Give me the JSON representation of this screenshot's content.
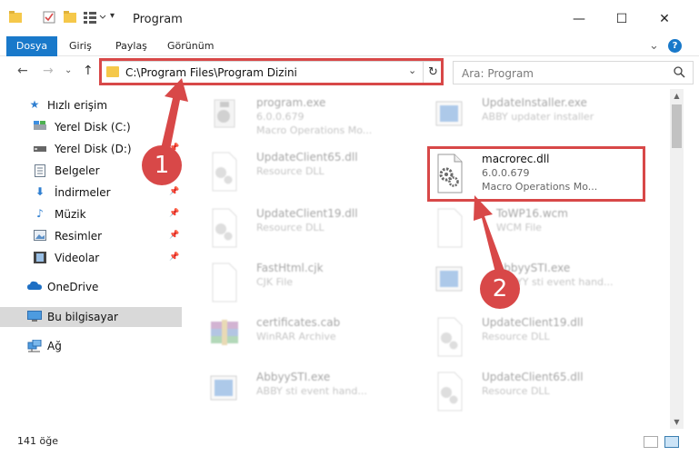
{
  "window": {
    "title": "Program",
    "minimize": "—",
    "maximize": "☐",
    "close": "✕"
  },
  "ribbon": {
    "tabs": [
      "Dosya",
      "Giriş",
      "Paylaş",
      "Görünüm"
    ],
    "expand": "⌄",
    "help": "?"
  },
  "address": {
    "path": "C:\\Program Files\\Program Dizini",
    "dropdown": "⌄",
    "refresh": "↻"
  },
  "search": {
    "placeholder": "Ara: Program",
    "icon": "search-icon"
  },
  "nav": {
    "back": "←",
    "forward": "→",
    "recent": "⌄",
    "up": "↑",
    "items": [
      {
        "label": "Hızlı erişim",
        "icon": "star-icon",
        "pinned": false
      },
      {
        "label": "Yerel Disk (C:)",
        "icon": "drive-icon",
        "pinned": true
      },
      {
        "label": "Yerel Disk (D:)",
        "icon": "drive-icon",
        "pinned": true
      },
      {
        "label": "Belgeler",
        "icon": "document-icon",
        "pinned": true
      },
      {
        "label": "İndirmeler",
        "icon": "download-icon",
        "pinned": true
      },
      {
        "label": "Müzik",
        "icon": "music-icon",
        "pinned": true
      },
      {
        "label": "Resimler",
        "icon": "pictures-icon",
        "pinned": true
      },
      {
        "label": "Videolar",
        "icon": "video-icon",
        "pinned": true
      },
      {
        "label": "OneDrive",
        "icon": "cloud-icon",
        "pinned": false
      },
      {
        "label": "Bu bilgisayar",
        "icon": "computer-icon",
        "pinned": false
      },
      {
        "label": "Ağ",
        "icon": "network-icon",
        "pinned": false
      }
    ]
  },
  "files": [
    {
      "name": "program.exe",
      "line1": "6.0.0.679",
      "line2": "Macro Operations Mo...",
      "icon": "exe-icon",
      "faded": true
    },
    {
      "name": "UpdateInstaller.exe",
      "line1": "ABBY updater installer",
      "line2": "",
      "icon": "installer-icon",
      "faded": true
    },
    {
      "name": "UpdateClient65.dll",
      "line1": "Resource DLL",
      "line2": "",
      "icon": "dll-icon",
      "faded": true
    },
    {
      "name": "macrorec.dll",
      "line1": "6.0.0.679",
      "line2": "Macro Operations Mo...",
      "icon": "dll-icon",
      "faded": false
    },
    {
      "name": "UpdateClient19.dll",
      "line1": "Resource DLL",
      "line2": "",
      "icon": "dll-icon",
      "faded": true
    },
    {
      "name": "ToWP16.wcm",
      "line1": "WCM File",
      "line2": "",
      "icon": "file-icon",
      "faded": true
    },
    {
      "name": "FastHtml.cjk",
      "line1": "CJK File",
      "line2": "",
      "icon": "file-icon",
      "faded": true
    },
    {
      "name": "AbbyySTI.exe",
      "line1": "ABBYY sti event hand...",
      "line2": "",
      "icon": "exe-icon",
      "faded": true
    },
    {
      "name": "certificates.cab",
      "line1": "WinRAR Archive",
      "line2": "",
      "icon": "archive-icon",
      "faded": true
    },
    {
      "name": "UpdateClient19.dll",
      "line1": "Resource DLL",
      "line2": "",
      "icon": "dll-icon",
      "faded": true
    },
    {
      "name": "AbbyySTI.exe",
      "line1": "ABBY sti event hand...",
      "line2": "",
      "icon": "exe-icon",
      "faded": true
    },
    {
      "name": "UpdateClient65.dll",
      "line1": "Resource DLL",
      "line2": "",
      "icon": "dll-icon",
      "faded": true
    }
  ],
  "status": {
    "count": "141 öğe"
  },
  "annotations": {
    "step1": "1",
    "step2": "2",
    "color": "#d84848"
  }
}
